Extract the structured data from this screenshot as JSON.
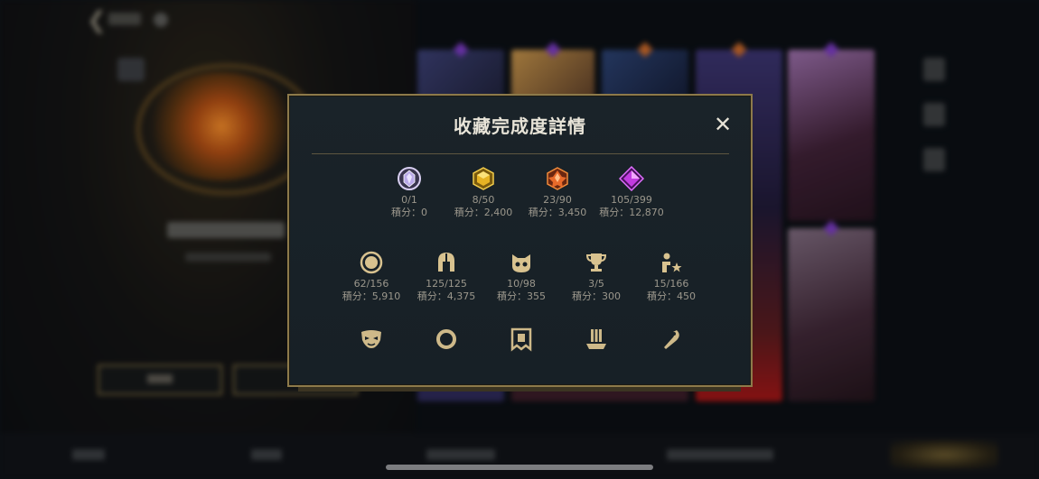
{
  "modal": {
    "title": "收藏完成度詳情",
    "close_glyph": "✕"
  },
  "rarity_stats": [
    {
      "icon": "hextech-gem-icon",
      "count": "0/1",
      "score": "積分：0",
      "color": "#b9a9e8"
    },
    {
      "icon": "gold-gem-icon",
      "count": "8/50",
      "score": "積分：2,400",
      "color": "#e6b324"
    },
    {
      "icon": "orange-gem-icon",
      "count": "23/90",
      "score": "積分：3,450",
      "color": "#e86a2a"
    },
    {
      "icon": "purple-gem-icon",
      "count": "105/399",
      "score": "積分：12,870",
      "color": "#c23be0"
    }
  ],
  "category_stats": [
    {
      "icon": "ward-ring-icon",
      "count": "62/156",
      "score": "積分：5,910"
    },
    {
      "icon": "helmet-icon",
      "count": "125/125",
      "score": "積分：4,375"
    },
    {
      "icon": "cat-face-icon",
      "count": "10/98",
      "score": "積分：355"
    },
    {
      "icon": "trophy-icon",
      "count": "3/5",
      "score": "積分：300"
    },
    {
      "icon": "emote-person-icon",
      "count": "15/166",
      "score": "積分：450"
    }
  ],
  "more_stats": [
    {
      "icon": "mask-icon"
    },
    {
      "icon": "ring-icon"
    },
    {
      "icon": "banner-frame-icon"
    },
    {
      "icon": "podium-icon"
    },
    {
      "icon": "hook-icon"
    }
  ],
  "colors": {
    "accent_gold": "#8d7a4a",
    "icon_gold": "#d8c28f",
    "modal_bg": "#1a2329",
    "text_muted": "#9b978c"
  }
}
